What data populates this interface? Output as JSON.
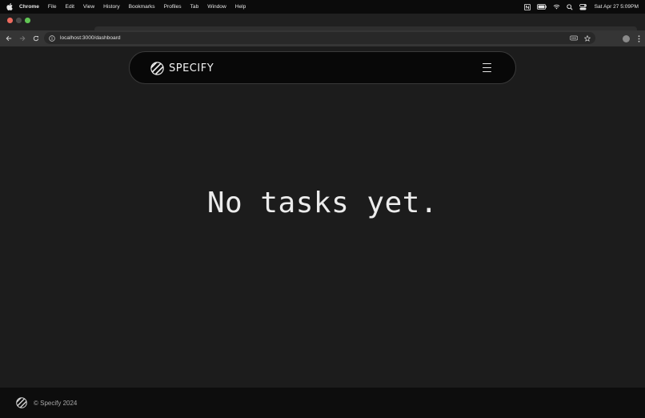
{
  "menubar": {
    "app_name": "Chrome",
    "items": [
      "File",
      "Edit",
      "View",
      "History",
      "Bookmarks",
      "Profiles",
      "Tab",
      "Window",
      "Help"
    ],
    "clock": "Sat Apr 27  5:09PM"
  },
  "browser": {
    "url": "localhost:3000/dashboard"
  },
  "header": {
    "brand": "SPECIFY"
  },
  "main": {
    "empty_message": "No tasks yet."
  },
  "footer": {
    "copyright": "© Specify 2024"
  }
}
